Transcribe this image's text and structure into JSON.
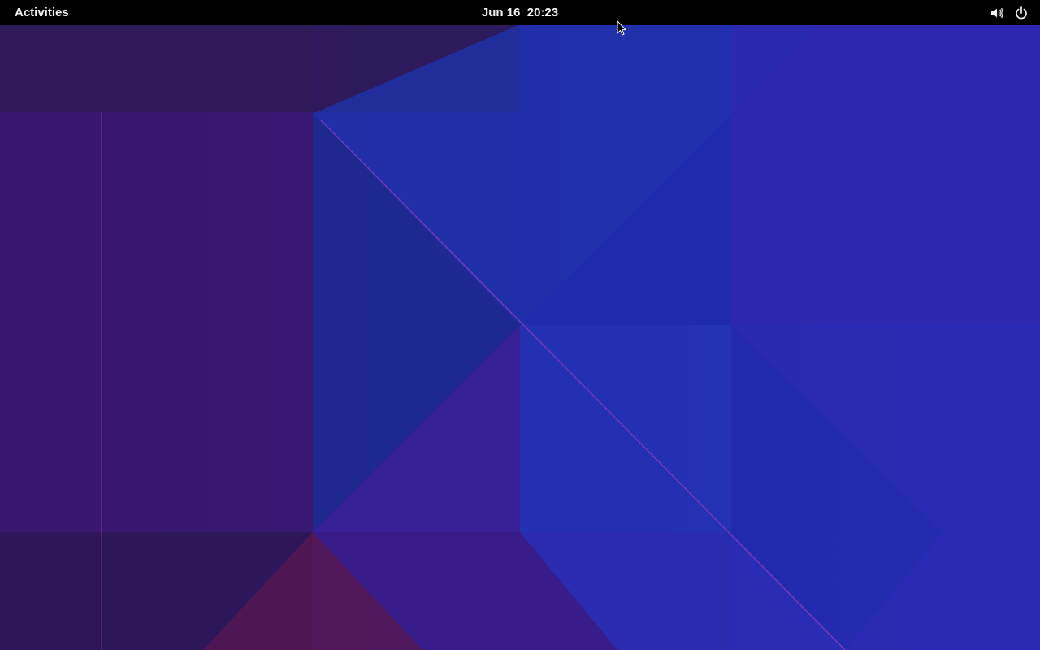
{
  "top_bar": {
    "activities_label": "Activities",
    "date": "Jun 16",
    "time": "20:23",
    "status_icons": [
      "volume-icon",
      "power-icon"
    ]
  },
  "desktop": {
    "wallpaper": "geometric-blue-purple",
    "colors": {
      "panel_bg": "#000000",
      "panel_text": "#f2f2f2",
      "wallpaper_blue": "#2528b0",
      "wallpaper_purple": "#3a1a78",
      "wallpaper_magenta": "#5a1450"
    }
  }
}
